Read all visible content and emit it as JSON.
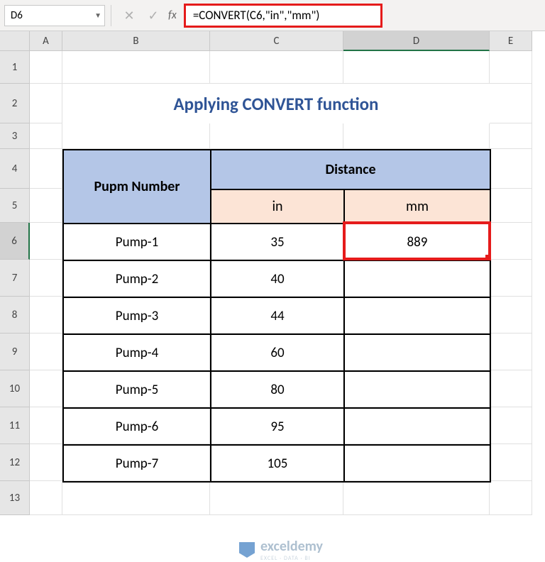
{
  "name_box": "D6",
  "formula": "=CONVERT(C6,\"in\",\"mm\")",
  "columns": [
    "A",
    "B",
    "C",
    "D",
    "E"
  ],
  "selected_col": "D",
  "rows": [
    "1",
    "2",
    "3",
    "4",
    "5",
    "6",
    "7",
    "8",
    "9",
    "10",
    "11",
    "12",
    "13"
  ],
  "selected_row": "6",
  "title": "Applying CONVERT function",
  "headers": {
    "pump": "Pupm Number",
    "distance": "Distance",
    "in": "in",
    "mm": "mm"
  },
  "table": [
    {
      "pump": "Pump-1",
      "in": "35",
      "mm": "889"
    },
    {
      "pump": "Pump-2",
      "in": "40",
      "mm": ""
    },
    {
      "pump": "Pump-3",
      "in": "44",
      "mm": ""
    },
    {
      "pump": "Pump-4",
      "in": "60",
      "mm": ""
    },
    {
      "pump": "Pump-5",
      "in": "80",
      "mm": ""
    },
    {
      "pump": "Pump-6",
      "in": "95",
      "mm": ""
    },
    {
      "pump": "Pump-7",
      "in": "105",
      "mm": ""
    }
  ],
  "watermark": {
    "brand": "exceldemy",
    "tag": "EXCEL · DATA · BI"
  }
}
